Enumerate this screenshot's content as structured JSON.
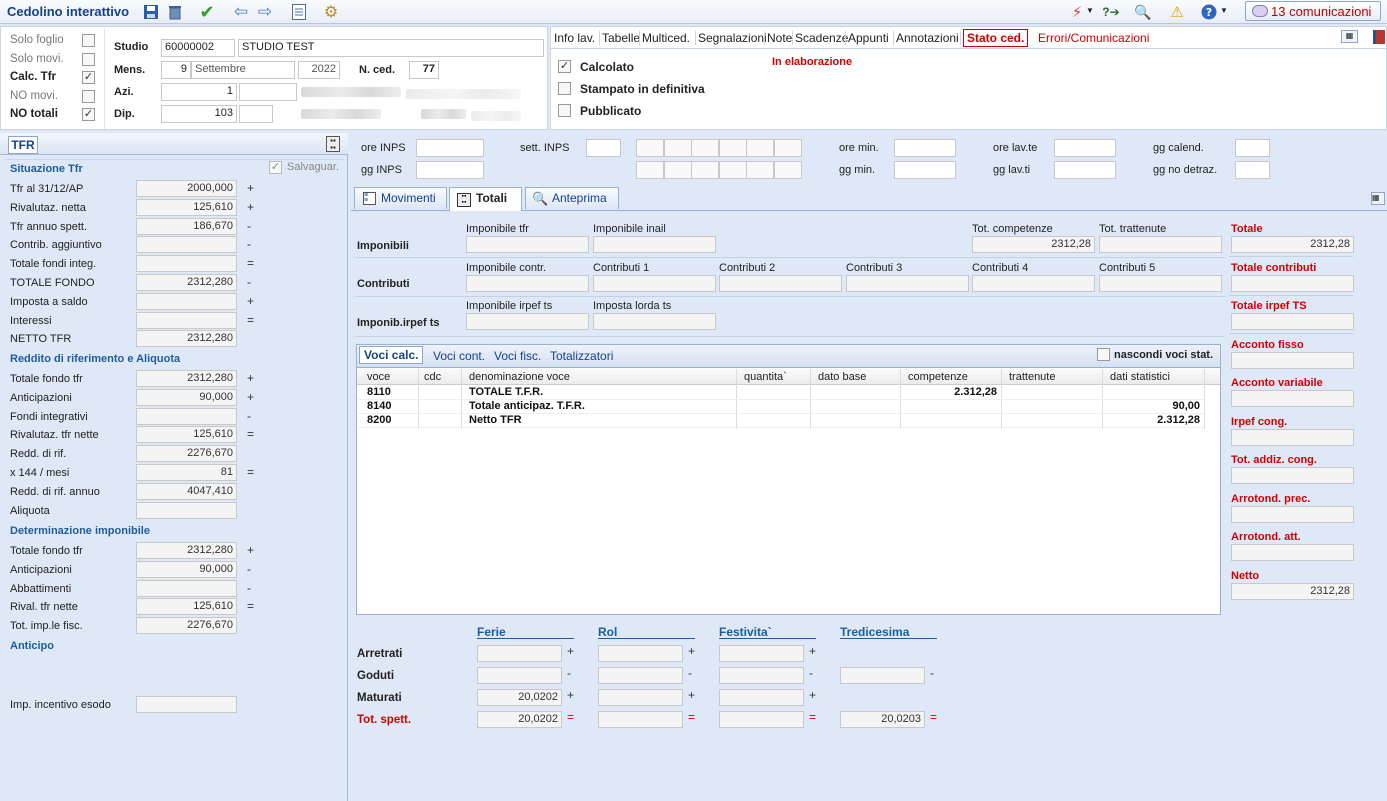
{
  "toolbar": {
    "title": "Cedolino interattivo",
    "communications_label": "13 comunicazioni"
  },
  "header": {
    "flags": [
      {
        "label": "Solo foglio",
        "checked": false,
        "bold": false
      },
      {
        "label": "Solo movi.",
        "checked": false,
        "bold": false
      },
      {
        "label": "Calc. Tfr",
        "checked": true,
        "bold": true
      },
      {
        "label": "NO movi.",
        "checked": false,
        "bold": false
      },
      {
        "label": "NO totali",
        "checked": true,
        "bold": true
      }
    ],
    "studio_label": "Studio",
    "studio_code": "60000002",
    "studio_name": "STUDIO TEST",
    "mens_label": "Mens.",
    "mens_month_num": "9",
    "mens_month": "Settembre",
    "mens_year": "2022",
    "nced_label": "N. ced.",
    "nced_value": "77",
    "azi_label": "Azi.",
    "azi_value": "1",
    "dip_label": "Dip.",
    "dip_value": "103"
  },
  "status_tabs": [
    "Info lav.",
    "Tabelle",
    "Multiced.",
    "Segnalazioni",
    "Note",
    "Scadenze",
    "Appunti",
    "Annotazioni",
    "Stato ced.",
    "Errori/Comunicazioni"
  ],
  "status": {
    "calcolato_label": "Calcolato",
    "calcolato_checked": true,
    "stampato_label": "Stampato in definitiva",
    "stampato_checked": false,
    "pubblicato_label": "Pubblicato",
    "pubblicato_checked": false,
    "state_text": "In elaborazione"
  },
  "tfr": {
    "tab_label": "TFR",
    "salvaguar_label": "Salvaguar.",
    "sections": {
      "situazione": "Situazione Tfr",
      "reddito": "Reddito di riferimento e Aliquota",
      "determinazione": "Determinazione imponibile",
      "anticipo": "Anticipo"
    },
    "situazione_rows": [
      {
        "label": "Tfr al 31/12/AP",
        "value": "2000,000",
        "op": "+"
      },
      {
        "label": "Rivalutaz. netta",
        "value": "125,610",
        "op": "+"
      },
      {
        "label": "Tfr annuo spett.",
        "value": "186,670",
        "op": "-"
      },
      {
        "label": "Contrib. aggiuntivo",
        "value": "",
        "op": "-"
      },
      {
        "label": "Totale fondi integ.",
        "value": "",
        "op": "="
      },
      {
        "label": "TOTALE FONDO",
        "value": "2312,280",
        "op": "-"
      },
      {
        "label": "Imposta a saldo",
        "value": "",
        "op": "+"
      },
      {
        "label": "Interessi",
        "value": "",
        "op": "="
      },
      {
        "label": "NETTO TFR",
        "value": "2312,280",
        "op": ""
      }
    ],
    "reddito_rows": [
      {
        "label": "Totale fondo tfr",
        "value": "2312,280",
        "op": "+"
      },
      {
        "label": "Anticipazioni",
        "value": "90,000",
        "op": "+"
      },
      {
        "label": "Fondi integrativi",
        "value": "",
        "op": "-"
      },
      {
        "label": "Rivalutaz. tfr nette",
        "value": "125,610",
        "op": "="
      },
      {
        "label": "Redd. di rif.",
        "value": "2276,670",
        "op": ""
      },
      {
        "label": "x 144 / mesi",
        "value": "81",
        "op": "="
      },
      {
        "label": "Redd. di rif. annuo",
        "value": "4047,410",
        "op": ""
      },
      {
        "label": "Aliquota",
        "value": "",
        "op": ""
      }
    ],
    "determ_rows": [
      {
        "label": "Totale fondo tfr",
        "value": "2312,280",
        "op": "+"
      },
      {
        "label": "Anticipazioni",
        "value": "90,000",
        "op": "-"
      },
      {
        "label": "Abbattimenti",
        "value": "",
        "op": "-"
      },
      {
        "label": "Rival. tfr nette",
        "value": "125,610",
        "op": "="
      },
      {
        "label": "Tot. imp.le fisc.",
        "value": "2276,670",
        "op": ""
      }
    ],
    "incentivo_label": "Imp. incentivo esodo"
  },
  "counters": {
    "ore_inps": "ore INPS",
    "gg_inps": "gg INPS",
    "sett_inps": "sett. INPS",
    "ore_min": "ore min.",
    "gg_min": "gg min.",
    "ore_lavte": "ore lav.te",
    "gg_lavti": "gg lav.ti",
    "gg_calend": "gg calend.",
    "gg_nodetraz": "gg no detraz."
  },
  "main_tabs": [
    "Movimenti",
    "Totali",
    "Anteprima"
  ],
  "totali": {
    "imponibili_label": "Imponibili",
    "imp_tfr": "Imponibile tfr",
    "imp_inail": "Imponibile inail",
    "tot_comp": "Tot. competenze",
    "tot_comp_value": "2312,28",
    "tot_tratt": "Tot. trattenute",
    "contributi_label": "Contributi",
    "imp_contr": "Imponibile contr.",
    "contr1": "Contributi 1",
    "contr2": "Contributi 2",
    "contr3": "Contributi 3",
    "contr4": "Contributi 4",
    "contr5": "Contributi 5",
    "irpef_label": "Imponib.irpef ts",
    "imp_irpef": "Imponibile irpef ts",
    "imposta_lorda": "Imposta lorda ts"
  },
  "right_totals": [
    {
      "label": "Totale",
      "value": "2312,28"
    },
    {
      "label": "Totale contributi",
      "value": ""
    },
    {
      "label": "Totale irpef TS",
      "value": ""
    },
    {
      "label": "Acconto fisso",
      "value": ""
    },
    {
      "label": "Acconto variabile",
      "value": ""
    },
    {
      "label": "Irpef cong.",
      "value": ""
    },
    {
      "label": "Tot. addiz. cong.",
      "value": ""
    },
    {
      "label": "Arrotond. prec.",
      "value": ""
    },
    {
      "label": "Arrotond. att.",
      "value": ""
    },
    {
      "label": "Netto",
      "value": "2312,28"
    }
  ],
  "voci": {
    "tabs": [
      "Voci calc.",
      "Voci cont.",
      "Voci fisc.",
      "Totalizzatori"
    ],
    "hide_label": "nascondi voci stat.",
    "columns": [
      "voce",
      "cdc",
      "denominazione voce",
      "quantita`",
      "dato base",
      "competenze",
      "trattenute",
      "dati statistici"
    ],
    "rows": [
      {
        "voce": "8110",
        "cdc": "",
        "den": "TOTALE T.F.R.",
        "qta": "",
        "base": "",
        "comp": "2.312,28",
        "tratt": "",
        "stat": ""
      },
      {
        "voce": "8140",
        "cdc": "",
        "den": "Totale anticipaz. T.F.R.",
        "qta": "",
        "base": "",
        "comp": "",
        "tratt": "",
        "stat": "90,00"
      },
      {
        "voce": "8200",
        "cdc": "",
        "den": "Netto TFR",
        "qta": "",
        "base": "",
        "comp": "",
        "tratt": "",
        "stat": "2.312,28"
      }
    ]
  },
  "ferie": {
    "cols": [
      "Ferie",
      "Rol",
      "Festivita`",
      "Tredicesima"
    ],
    "rows": [
      {
        "label": "Arretrati",
        "red": false,
        "values": [
          "",
          "",
          ""
        ],
        "ops": [
          "+",
          "+",
          "+"
        ]
      },
      {
        "label": "Goduti",
        "red": false,
        "values": [
          "",
          "",
          "",
          ""
        ],
        "ops": [
          "-",
          "-",
          "-",
          "-"
        ]
      },
      {
        "label": "Maturati",
        "red": false,
        "values": [
          "20,0202",
          "",
          ""
        ],
        "ops": [
          "+",
          "+",
          "+"
        ]
      },
      {
        "label": "Tot. spett.",
        "red": true,
        "values": [
          "20,0202",
          "",
          "",
          "20,0203"
        ],
        "ops": [
          "=",
          "=",
          "=",
          "="
        ]
      }
    ]
  },
  "colors": {
    "accent": "#1e5c9c",
    "red": "#d40000",
    "bg": "#dfe8f6"
  }
}
